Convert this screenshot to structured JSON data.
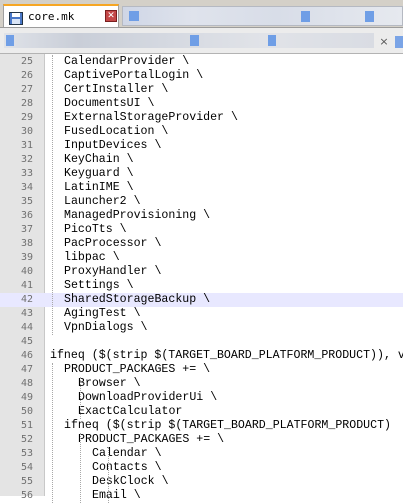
{
  "tabs": [
    {
      "label": "core.mk",
      "icon": "save-disk-icon",
      "close_icon": "close-icon"
    }
  ],
  "secondary_bar": {
    "close_label": "×"
  },
  "editor": {
    "lines": [
      {
        "num": "25",
        "text": "CalendarProvider \\",
        "indent": 2
      },
      {
        "num": "26",
        "text": "CaptivePortalLogin \\",
        "indent": 2
      },
      {
        "num": "27",
        "text": "CertInstaller \\",
        "indent": 2
      },
      {
        "num": "28",
        "text": "DocumentsUI \\",
        "indent": 2
      },
      {
        "num": "29",
        "text": "ExternalStorageProvider \\",
        "indent": 2
      },
      {
        "num": "30",
        "text": "FusedLocation \\",
        "indent": 2
      },
      {
        "num": "31",
        "text": "InputDevices \\",
        "indent": 2
      },
      {
        "num": "32",
        "text": "KeyChain \\",
        "indent": 2
      },
      {
        "num": "33",
        "text": "Keyguard \\",
        "indent": 2
      },
      {
        "num": "34",
        "text": "LatinIME \\",
        "indent": 2
      },
      {
        "num": "35",
        "text": "Launcher2 \\",
        "indent": 2
      },
      {
        "num": "36",
        "text": "ManagedProvisioning \\",
        "indent": 2
      },
      {
        "num": "37",
        "text": "PicoTts \\",
        "indent": 2
      },
      {
        "num": "38",
        "text": "PacProcessor \\",
        "indent": 2
      },
      {
        "num": "39",
        "text": "libpac \\",
        "indent": 2
      },
      {
        "num": "40",
        "text": "ProxyHandler \\",
        "indent": 2
      },
      {
        "num": "41",
        "text": "Settings \\",
        "indent": 2
      },
      {
        "num": "42",
        "text": "SharedStorageBackup \\",
        "indent": 2,
        "highlight": true
      },
      {
        "num": "43",
        "text": "AgingTest \\",
        "indent": 2
      },
      {
        "num": "44",
        "text": "VpnDialogs \\",
        "indent": 2
      },
      {
        "num": "45",
        "text": "",
        "indent": 0
      },
      {
        "num": "46",
        "text": "ifneq ($(strip $(TARGET_BOARD_PLATFORM_PRODUCT)), v",
        "indent": 0
      },
      {
        "num": "47",
        "text": "PRODUCT_PACKAGES += \\",
        "indent": 2
      },
      {
        "num": "48",
        "text": "Browser \\",
        "indent": 4
      },
      {
        "num": "49",
        "text": "DownloadProviderUi \\",
        "indent": 4
      },
      {
        "num": "50",
        "text": "ExactCalculator",
        "indent": 4
      },
      {
        "num": "51",
        "text": "ifneq ($(strip $(TARGET_BOARD_PLATFORM_PRODUCT)",
        "indent": 2
      },
      {
        "num": "52",
        "text": "PRODUCT_PACKAGES += \\",
        "indent": 4
      },
      {
        "num": "53",
        "text": "Calendar \\",
        "indent": 6
      },
      {
        "num": "54",
        "text": "Contacts \\",
        "indent": 6
      },
      {
        "num": "55",
        "text": "DeskClock \\",
        "indent": 6
      },
      {
        "num": "56",
        "text": "Email \\",
        "indent": 6
      }
    ]
  }
}
